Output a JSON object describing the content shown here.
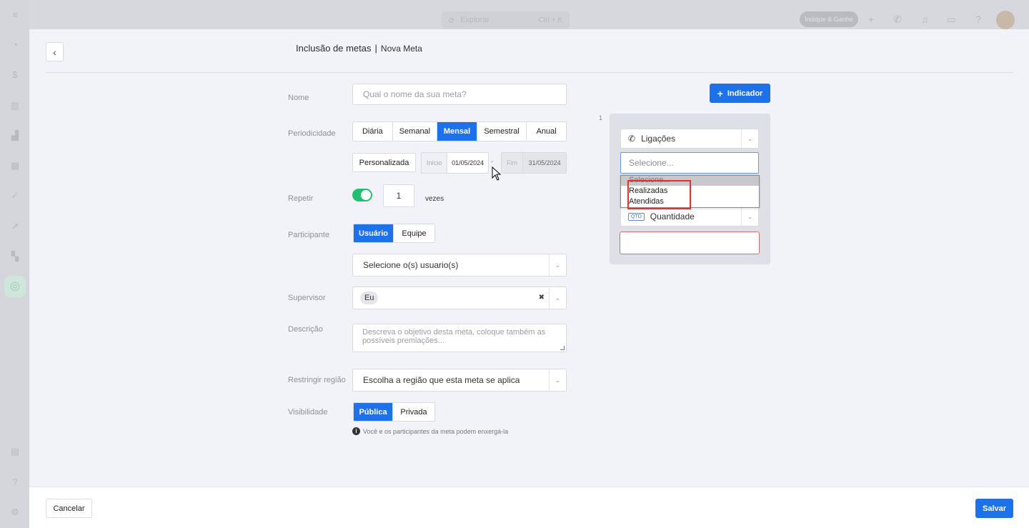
{
  "topbar": {
    "explore_label": "Explorar",
    "explore_shortcut": "Ctrl + K",
    "indique_label": "Indique & Ganhe"
  },
  "header": {
    "title": "Inclusão de metas",
    "separator": "|",
    "subtitle": "Nova Meta"
  },
  "form": {
    "nome": {
      "label": "Nome",
      "placeholder": "Qual o nome da sua meta?"
    },
    "periodicidade": {
      "label": "Periodicidade",
      "options": [
        "Diária",
        "Semanal",
        "Mensal",
        "Semestral",
        "Anual"
      ],
      "selected": "Mensal",
      "custom_label": "Personalizada",
      "inicio_label": "Início",
      "inicio_value": "01/05/2024",
      "range_sep": "-",
      "fim_label": "Fim",
      "fim_value": "31/05/2024"
    },
    "repetir": {
      "label": "Repetir",
      "enabled": true,
      "value": "1",
      "suffix": "vezes"
    },
    "participante": {
      "label": "Participante",
      "options": [
        "Usuário",
        "Equipe"
      ],
      "selected": "Usuário",
      "select_placeholder": "Selecione o(s) usuario(s)"
    },
    "supervisor": {
      "label": "Supervisor",
      "chip": "Eu",
      "clear_icon": "✖"
    },
    "descricao": {
      "label": "Descrição",
      "placeholder": "Descreva o objetivo desta meta, coloque também as possíveis premiações..."
    },
    "regiao": {
      "label": "Restringir região",
      "placeholder": "Escolha a região que esta meta se aplica"
    },
    "visibilidade": {
      "label": "Visibilidade",
      "options": [
        "Pública",
        "Privada"
      ],
      "selected": "Pública",
      "hint": "Você e os participantes da meta podem enxergá-la"
    }
  },
  "indicator": {
    "add_label": "Indicador",
    "index": "1",
    "type": "Ligações",
    "sub_placeholder": "Selecione...",
    "dropdown_options": [
      "Selecione...",
      "Realizadas",
      "Atendidas"
    ],
    "measure_badge": "QTD",
    "measure": "Quantidade"
  },
  "footer": {
    "cancel_label": "Cancelar",
    "save_label": "Salvar"
  },
  "colors": {
    "primary": "#1d72ec",
    "toggle_on": "#21c06e",
    "error": "#e06a6a",
    "highlight": "#e03131"
  }
}
